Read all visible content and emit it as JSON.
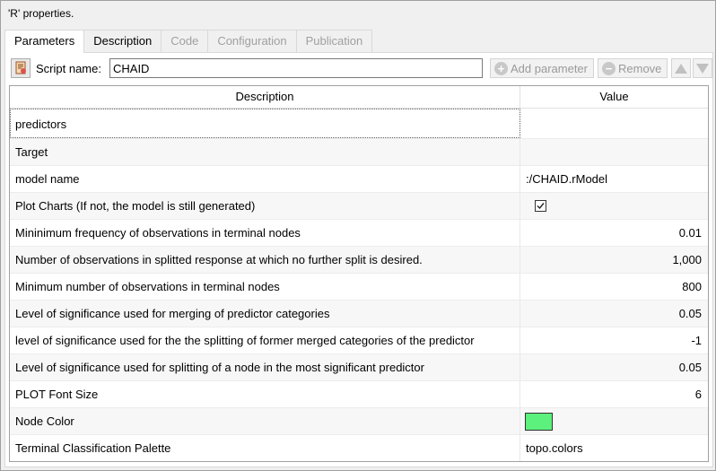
{
  "window": {
    "title": "'R' properties."
  },
  "tabs": [
    {
      "label": "Parameters",
      "state": "active"
    },
    {
      "label": "Description",
      "state": "normal"
    },
    {
      "label": "Code",
      "state": "disabled"
    },
    {
      "label": "Configuration",
      "state": "disabled"
    },
    {
      "label": "Publication",
      "state": "disabled"
    }
  ],
  "toolbar": {
    "script_name_label": "Script name:",
    "script_name_value": "CHAID",
    "add_parameter_label": "Add parameter",
    "remove_label": "Remove"
  },
  "table": {
    "headers": {
      "description": "Description",
      "value": "Value"
    },
    "rows": [
      {
        "description": "predictors",
        "value": ""
      },
      {
        "description": "Target",
        "value": ""
      },
      {
        "description": "model name",
        "value": ":/CHAID.rModel"
      },
      {
        "description": "Plot Charts (If not, the model is still generated)",
        "value": "",
        "checked": true
      },
      {
        "description": "Mininimum frequency of observations in terminal nodes",
        "value": "0.01"
      },
      {
        "description": "Number of observations in splitted response at which no further split is desired.",
        "value": "1,000"
      },
      {
        "description": "Minimum number of observations in terminal nodes",
        "value": "800"
      },
      {
        "description": "Level of significance used for merging of predictor categories",
        "value": "0.05"
      },
      {
        "description": "level of significance used for the the splitting of former merged categories of the predictor",
        "value": "-1"
      },
      {
        "description": "Level of significance used for splitting of a node in the most significant predictor",
        "value": "0.05"
      },
      {
        "description": "PLOT Font Size",
        "value": "6"
      },
      {
        "description": "Node Color",
        "value": "",
        "color": "#5cf07c"
      },
      {
        "description": "Terminal Classification Palette",
        "value": "topo.colors"
      }
    ]
  }
}
